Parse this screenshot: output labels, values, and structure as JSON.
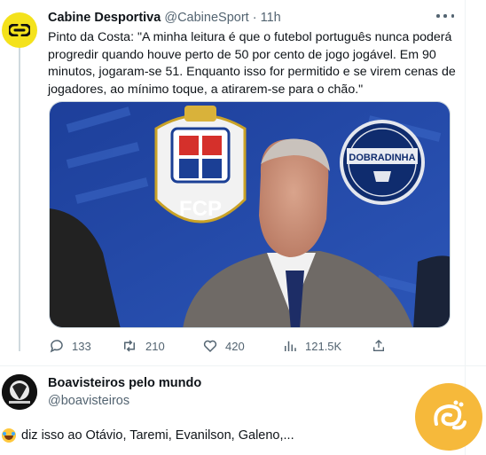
{
  "tweet": {
    "author_name": "Cabine Desportiva",
    "author_handle": "@CabineSport",
    "separator": "·",
    "time": "11h",
    "text_lines": [
      "Pinto da Costa: \"A minha leitura é que o futebol português nunca poderá",
      "progredir quando houve perto de 50 por cento de jogo jogável. Em 90",
      "minutos, jogaram-se  51. Enquanto isso for permitido e se virem cenas de",
      "jogadores, ao mínimo toque, a atirarem-se para o chão.\""
    ],
    "media": {
      "crest_letters": "FCP",
      "badge_text": "DOBRADINHA"
    },
    "actions": {
      "replies": "133",
      "retweets": "210",
      "likes": "420",
      "views": "121.5K"
    }
  },
  "reply": {
    "author_name": "Boavisteiros pelo mundo",
    "author_handle": "@boavisteiros",
    "text": "diz isso ao Otávio, Taremi, Evanilson, Galeno,..."
  },
  "colors": {
    "text": "#0f1419",
    "secondary": "#536471",
    "avatar_yellow": "#f4e21c",
    "watermark": "#f6b93b"
  },
  "icons": [
    "link-logo-icon",
    "more-icon",
    "reply-icon",
    "retweet-icon",
    "like-icon",
    "views-icon",
    "share-icon",
    "laughing-emoji-icon",
    "watermark-logo-icon"
  ]
}
